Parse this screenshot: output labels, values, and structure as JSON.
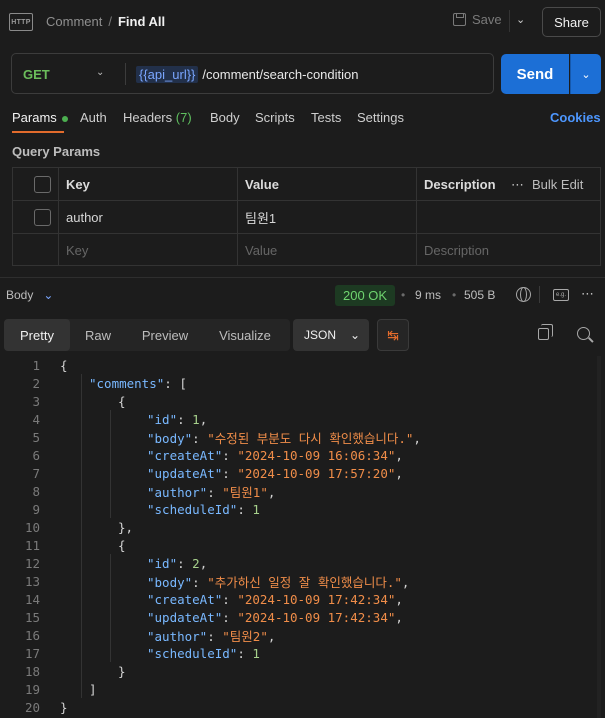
{
  "header": {
    "http_badge": "HTTP",
    "breadcrumb_parent": "Comment",
    "breadcrumb_sep": "/",
    "breadcrumb_current": "Find All",
    "save_label": "Save",
    "share_label": "Share"
  },
  "request": {
    "method": "GET",
    "url_var": "{{api_url}}",
    "url_path": "/comment/search-condition",
    "send_label": "Send"
  },
  "tabs": {
    "params": "Params",
    "auth": "Auth",
    "headers": "Headers",
    "headers_count": "(7)",
    "body": "Body",
    "scripts": "Scripts",
    "tests": "Tests",
    "settings": "Settings",
    "cookies": "Cookies"
  },
  "query_params": {
    "title": "Query Params",
    "col_key": "Key",
    "col_value": "Value",
    "col_description": "Description",
    "bulk_edit": "Bulk Edit",
    "rows": [
      {
        "key": "author",
        "value": "팀원1",
        "description": ""
      }
    ],
    "placeholder_key": "Key",
    "placeholder_value": "Value",
    "placeholder_description": "Description"
  },
  "response": {
    "label": "Body",
    "status": "200 OK",
    "time": "9 ms",
    "size": "505 B",
    "views": {
      "pretty": "Pretty",
      "raw": "Raw",
      "preview": "Preview",
      "visualize": "Visualize"
    },
    "format": "JSON"
  },
  "code_lines": [
    {
      "n": "1",
      "indent": 0,
      "parts": [
        [
          "p",
          "{"
        ]
      ]
    },
    {
      "n": "2",
      "indent": 1,
      "parts": [
        [
          "k",
          "\"comments\""
        ],
        [
          "p",
          ": ["
        ]
      ]
    },
    {
      "n": "3",
      "indent": 2,
      "parts": [
        [
          "p",
          "{"
        ]
      ]
    },
    {
      "n": "4",
      "indent": 3,
      "parts": [
        [
          "k",
          "\"id\""
        ],
        [
          "p",
          ": "
        ],
        [
          "n",
          "1"
        ],
        [
          "p",
          ","
        ]
      ]
    },
    {
      "n": "5",
      "indent": 3,
      "parts": [
        [
          "k",
          "\"body\""
        ],
        [
          "p",
          ": "
        ],
        [
          "s",
          "\"수정된 부분도 다시 확인했습니다.\""
        ],
        [
          "p",
          ","
        ]
      ]
    },
    {
      "n": "6",
      "indent": 3,
      "parts": [
        [
          "k",
          "\"createAt\""
        ],
        [
          "p",
          ": "
        ],
        [
          "s",
          "\"2024-10-09 16:06:34\""
        ],
        [
          "p",
          ","
        ]
      ]
    },
    {
      "n": "7",
      "indent": 3,
      "parts": [
        [
          "k",
          "\"updateAt\""
        ],
        [
          "p",
          ": "
        ],
        [
          "s",
          "\"2024-10-09 17:57:20\""
        ],
        [
          "p",
          ","
        ]
      ]
    },
    {
      "n": "8",
      "indent": 3,
      "parts": [
        [
          "k",
          "\"author\""
        ],
        [
          "p",
          ": "
        ],
        [
          "s",
          "\"팀원1\""
        ],
        [
          "p",
          ","
        ]
      ]
    },
    {
      "n": "9",
      "indent": 3,
      "parts": [
        [
          "k",
          "\"scheduleId\""
        ],
        [
          "p",
          ": "
        ],
        [
          "n",
          "1"
        ]
      ]
    },
    {
      "n": "10",
      "indent": 2,
      "parts": [
        [
          "p",
          "},"
        ]
      ]
    },
    {
      "n": "11",
      "indent": 2,
      "parts": [
        [
          "p",
          "{"
        ]
      ]
    },
    {
      "n": "12",
      "indent": 3,
      "parts": [
        [
          "k",
          "\"id\""
        ],
        [
          "p",
          ": "
        ],
        [
          "n",
          "2"
        ],
        [
          "p",
          ","
        ]
      ]
    },
    {
      "n": "13",
      "indent": 3,
      "parts": [
        [
          "k",
          "\"body\""
        ],
        [
          "p",
          ": "
        ],
        [
          "s",
          "\"추가하신 일정 잘 확인했습니다.\""
        ],
        [
          "p",
          ","
        ]
      ]
    },
    {
      "n": "14",
      "indent": 3,
      "parts": [
        [
          "k",
          "\"createAt\""
        ],
        [
          "p",
          ": "
        ],
        [
          "s",
          "\"2024-10-09 17:42:34\""
        ],
        [
          "p",
          ","
        ]
      ]
    },
    {
      "n": "15",
      "indent": 3,
      "parts": [
        [
          "k",
          "\"updateAt\""
        ],
        [
          "p",
          ": "
        ],
        [
          "s",
          "\"2024-10-09 17:42:34\""
        ],
        [
          "p",
          ","
        ]
      ]
    },
    {
      "n": "16",
      "indent": 3,
      "parts": [
        [
          "k",
          "\"author\""
        ],
        [
          "p",
          ": "
        ],
        [
          "s",
          "\"팀원2\""
        ],
        [
          "p",
          ","
        ]
      ]
    },
    {
      "n": "17",
      "indent": 3,
      "parts": [
        [
          "k",
          "\"scheduleId\""
        ],
        [
          "p",
          ": "
        ],
        [
          "n",
          "1"
        ]
      ]
    },
    {
      "n": "18",
      "indent": 2,
      "parts": [
        [
          "p",
          "}"
        ]
      ]
    },
    {
      "n": "19",
      "indent": 1,
      "parts": [
        [
          "p",
          "]"
        ]
      ]
    },
    {
      "n": "20",
      "indent": 0,
      "parts": [
        [
          "p",
          "}"
        ]
      ]
    }
  ]
}
